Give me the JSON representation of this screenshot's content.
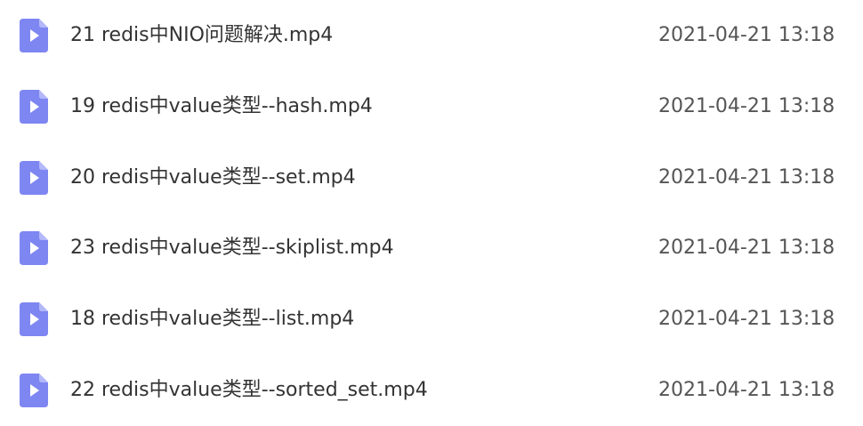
{
  "files": [
    {
      "name": "21 redis中NIO问题解决.mp4",
      "modified": "2021-04-21 13:18",
      "icon": "video-file-icon"
    },
    {
      "name": "19 redis中value类型--hash.mp4",
      "modified": "2021-04-21 13:18",
      "icon": "video-file-icon"
    },
    {
      "name": "20 redis中value类型--set.mp4",
      "modified": "2021-04-21 13:18",
      "icon": "video-file-icon"
    },
    {
      "name": "23 redis中value类型--skiplist.mp4",
      "modified": "2021-04-21 13:18",
      "icon": "video-file-icon"
    },
    {
      "name": "18 redis中value类型--list.mp4",
      "modified": "2021-04-21 13:18",
      "icon": "video-file-icon"
    },
    {
      "name": "22 redis中value类型--sorted_set.mp4",
      "modified": "2021-04-21 13:18",
      "icon": "video-file-icon"
    }
  ],
  "colors": {
    "icon_main": "#7e86f2",
    "icon_fold": "#b3b8fa",
    "play_triangle": "#ffffff"
  }
}
